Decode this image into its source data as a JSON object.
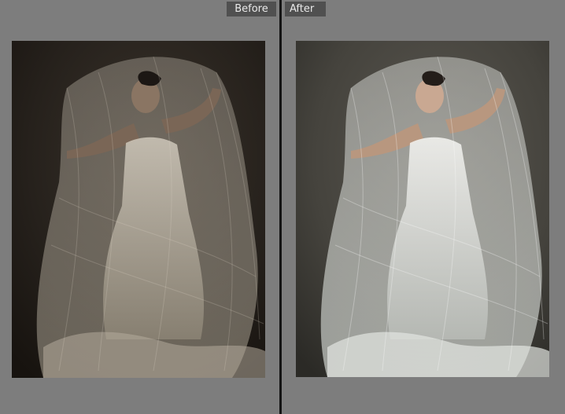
{
  "compare_view": {
    "before_label": "Before",
    "after_label": "After"
  },
  "colors": {
    "canvas_background": "#7d7d7d",
    "divider": "#141414",
    "label_background": "#505050",
    "label_text": "#eaeaea",
    "before_photo_tone": "#2b2620",
    "after_photo_tone": "#4a4841"
  }
}
